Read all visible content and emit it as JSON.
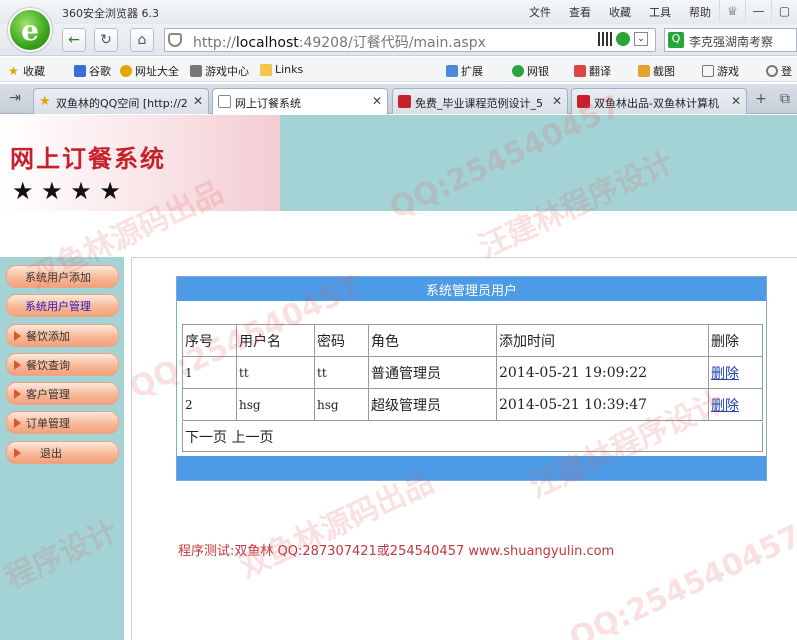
{
  "browser": {
    "app_title": "360安全浏览器 6.3",
    "menu": [
      "文件",
      "查看",
      "收藏",
      "工具",
      "帮助"
    ],
    "url_prefix": "http://",
    "url_host": "localhost",
    "url_rest": ":49208/订餐代码/main.aspx",
    "search_text": "李克强湖南考察",
    "favorites": [
      "收藏",
      "谷歌",
      "网址大全",
      "游戏中心",
      "Links"
    ],
    "toolbar_right": [
      "扩展",
      "网银",
      "翻译",
      "截图",
      "游戏",
      "登"
    ],
    "tabs": [
      {
        "label": "双鱼林的QQ空间 [http://2"
      },
      {
        "label": "网上订餐系统"
      },
      {
        "label": "免费_毕业课程范例设计_5"
      },
      {
        "label": "双鱼林出品-双鱼林计算机"
      }
    ]
  },
  "banner": {
    "title": "网上订餐系统",
    "stars": "★ ★ ★ ★"
  },
  "sidebar": {
    "items": [
      {
        "label": "系统用户添加"
      },
      {
        "label": "系统用户管理"
      },
      {
        "label": "餐饮添加"
      },
      {
        "label": "餐饮查询"
      },
      {
        "label": "客户管理"
      },
      {
        "label": "订单管理"
      },
      {
        "label": "退出"
      }
    ]
  },
  "panel": {
    "title": "系统管理员用户",
    "columns": [
      "序号",
      "用户名",
      "密码",
      "角色",
      "添加时间",
      "删除"
    ],
    "rows": [
      {
        "no": "1",
        "username": "tt",
        "password": "tt",
        "role": "普通管理员",
        "time": "2014-05-21 19:09:22",
        "action": "删除"
      },
      {
        "no": "2",
        "username": "hsg",
        "password": "hsg",
        "role": "超级管理员",
        "time": "2014-05-21 10:39:47",
        "action": "删除"
      }
    ],
    "pager": "下一页 上一页"
  },
  "credit": "程序测试:双鱼林 QQ:287307421或254540457 www.shuangyulin.com",
  "watermarks": [
    "双鱼林源码出品",
    "QQ:254540457",
    "汪建林程序设计",
    "QQ:254540457",
    "双鱼林源码出品",
    "汪建林程序设计",
    "QQ:254540457",
    "程序设计"
  ]
}
